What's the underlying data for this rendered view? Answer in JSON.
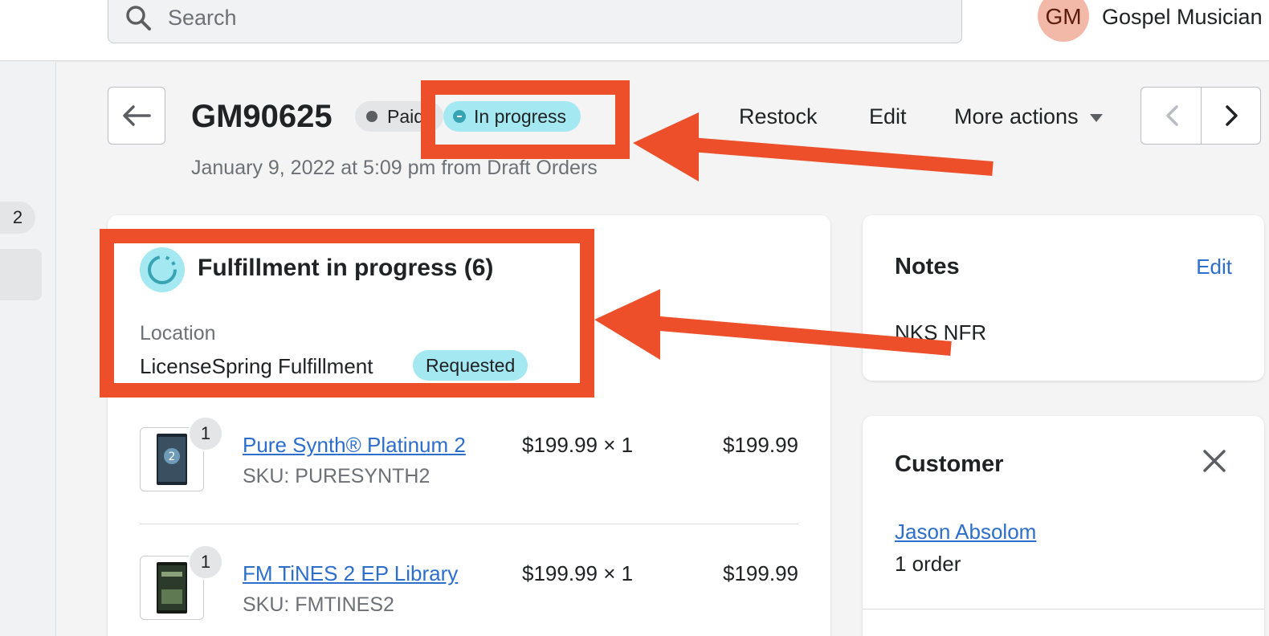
{
  "topbar": {
    "search_placeholder": "Search",
    "avatar_initials": "GM",
    "store_name": "Gospel Musician"
  },
  "leftnav": {
    "badge_count": "2"
  },
  "header": {
    "order_id": "GM90625",
    "payment_status": "Paid",
    "fulfillment_status": "In progress",
    "subtitle": "January 9, 2022 at 5:09 pm from Draft Orders",
    "actions": {
      "restock": "Restock",
      "edit": "Edit",
      "more": "More actions"
    }
  },
  "fulfillment": {
    "title": "Fulfillment in progress (6)",
    "location_label": "Location",
    "location_value": "LicenseSpring Fulfillment",
    "location_status": "Requested",
    "items": [
      {
        "qty": "1",
        "name": "Pure Synth® Platinum 2",
        "sku": "SKU: PURESYNTH2",
        "price": "$199.99 × 1",
        "total": "$199.99"
      },
      {
        "qty": "1",
        "name": "FM TiNES 2 EP Library",
        "sku": "SKU: FMTINES2",
        "price": "$199.99 × 1",
        "total": "$199.99"
      }
    ]
  },
  "notes": {
    "title": "Notes",
    "edit_label": "Edit",
    "text": "NKS NFR"
  },
  "customer": {
    "title": "Customer",
    "name": "Jason Absolom",
    "orders": "1 order"
  },
  "colors": {
    "annotation": "#ee4f2b",
    "link": "#2c6ecb",
    "status_info": "#a4e8f2"
  }
}
